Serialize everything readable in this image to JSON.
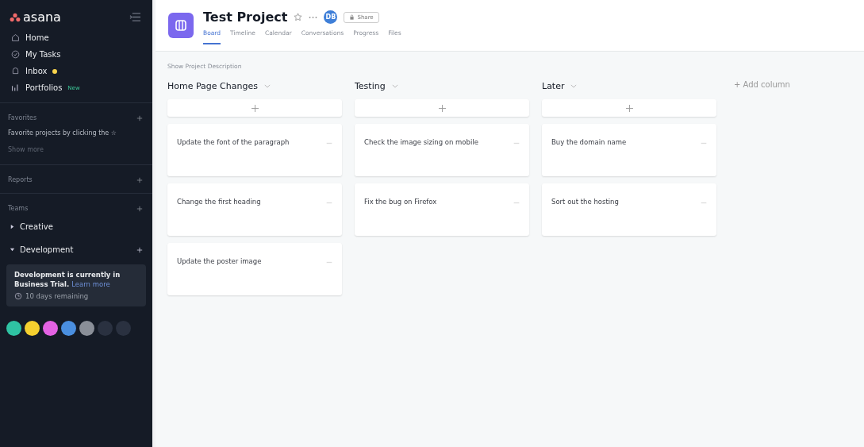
{
  "sidebar": {
    "logo": "asana",
    "nav": [
      {
        "label": "Home",
        "badge_dot": false
      },
      {
        "label": "My Tasks",
        "badge_dot": false
      },
      {
        "label": "Inbox",
        "badge_dot": true
      },
      {
        "label": "Portfolios",
        "badge_dot": false,
        "tag": "New"
      }
    ],
    "favorites": {
      "title": "Favorites",
      "hint": "Favorite projects by clicking the ☆",
      "more": "Show more"
    },
    "reports": {
      "title": "Reports"
    },
    "teams": {
      "title": "Teams",
      "items": [
        {
          "label": "Creative",
          "expanded": false
        },
        {
          "label": "Development",
          "expanded": true
        }
      ]
    },
    "trial": {
      "text": "Development is currently in Business Trial.",
      "link": "Learn more",
      "remaining": "10 days remaining"
    },
    "avatars": [
      {
        "color": "#2fc3a3"
      },
      {
        "color": "#f5d02f"
      },
      {
        "color": "#e362e3"
      },
      {
        "color": "#4a8fe0"
      },
      {
        "color": "#8a8f98"
      },
      {
        "color": "#2a3140"
      },
      {
        "color": "#2a3140"
      }
    ]
  },
  "project": {
    "title": "Test Project",
    "member": "DB",
    "share": "Share",
    "tabs": [
      {
        "label": "Board",
        "selected": true
      },
      {
        "label": "Timeline",
        "selected": false
      },
      {
        "label": "Calendar",
        "selected": false
      },
      {
        "label": "Conversations",
        "selected": false
      },
      {
        "label": "Progress",
        "selected": false
      },
      {
        "label": "Files",
        "selected": false
      }
    ],
    "description_link": "Show Project Description"
  },
  "columns": [
    {
      "title": "Home Page Changes",
      "tasks": [
        "Update the font of the paragraph",
        "Change the first heading",
        "Update the poster image"
      ]
    },
    {
      "title": "Testing",
      "tasks": [
        "Check the image sizing on mobile",
        "Fix the bug on Firefox"
      ]
    },
    {
      "title": "Later",
      "tasks": [
        "Buy the domain name",
        "Sort out the hosting"
      ]
    }
  ],
  "add_column": "+ Add column"
}
